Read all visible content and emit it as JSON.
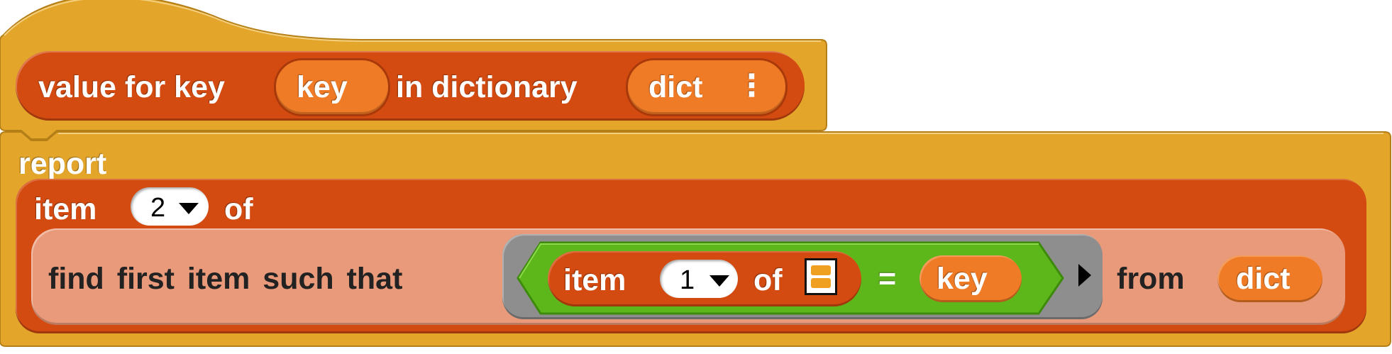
{
  "hat_block": {
    "prefix": "value for key",
    "param1": "key",
    "middle": "in dictionary",
    "param2": "dict",
    "menu_glyph": "⋮"
  },
  "report_block": {
    "label": "report",
    "item_block": {
      "label": "item",
      "index": "2",
      "of_label": "of",
      "find_block": {
        "label": "find first item such that",
        "predicate": {
          "item_label": "item",
          "index": "1",
          "of_label": "of",
          "equals": "=",
          "key_var": "key"
        },
        "from_label": "from",
        "dict_var": "dict"
      }
    }
  },
  "colors": {
    "custom_block": "#E3A52A",
    "list_block": "#D44B11",
    "variable": "#F07B26",
    "ring_light": "#E99A7A",
    "operator_green": "#5EB71A",
    "ring_gray": "#8E8E8E"
  },
  "icons": [
    "dropdown-caret-icon",
    "list-slot-icon",
    "arrow-right-icon",
    "vertical-dots-icon"
  ]
}
